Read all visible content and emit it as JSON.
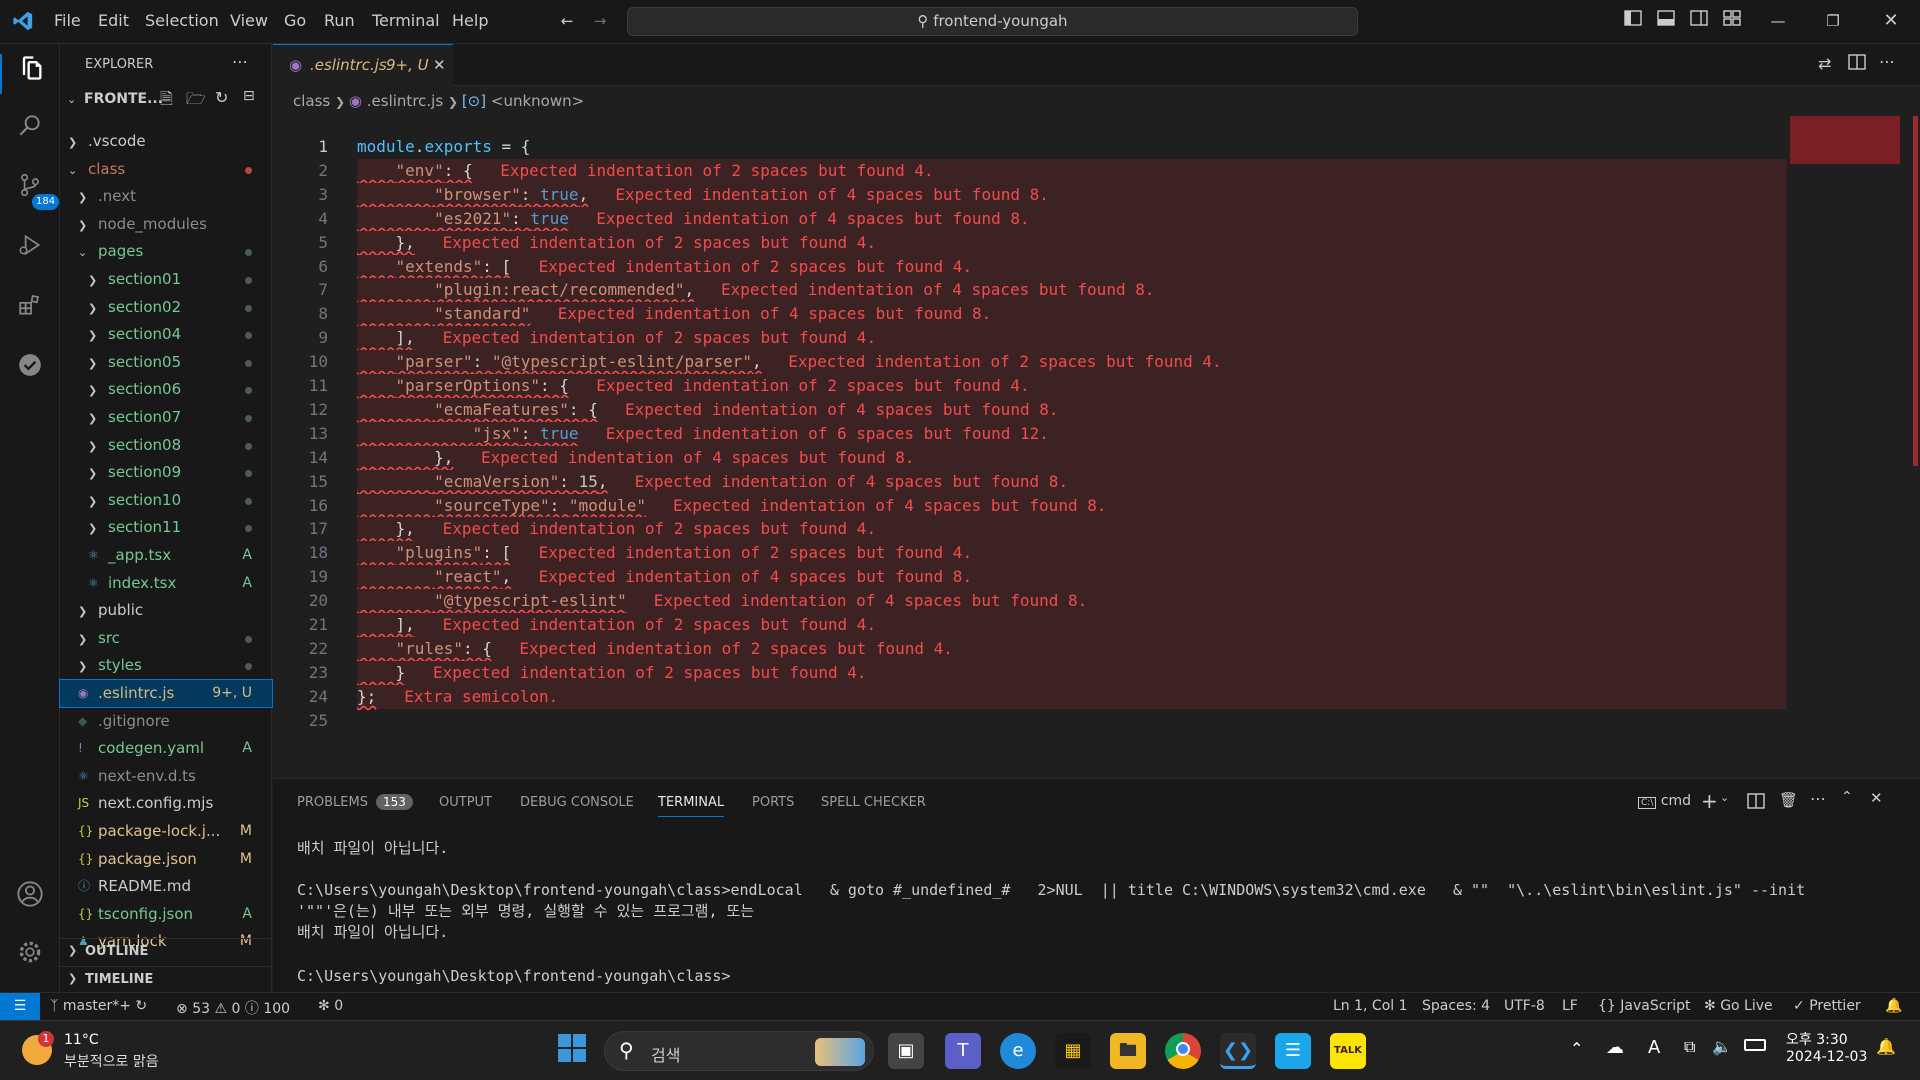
{
  "titlebar": {
    "menu": [
      "File",
      "Edit",
      "Selection",
      "View",
      "Go",
      "Run",
      "Terminal",
      "Help"
    ],
    "search_text": "frontend-youngah"
  },
  "activity": {
    "scm_badge": "184"
  },
  "explorer": {
    "title": "EXPLORER",
    "root": "FRONTE...",
    "rows": [
      {
        "label": ".vscode",
        "indent": 1,
        "kind": "folder",
        "status": ""
      },
      {
        "label": "class",
        "indent": 1,
        "kind": "folder-open",
        "status": "dot-red"
      },
      {
        "label": ".next",
        "indent": 2,
        "kind": "folder",
        "status": ""
      },
      {
        "label": "node_modules",
        "indent": 2,
        "kind": "folder",
        "status": ""
      },
      {
        "label": "pages",
        "indent": 2,
        "kind": "folder-open",
        "status": "dot"
      },
      {
        "label": "section01",
        "indent": 3,
        "kind": "folder",
        "status": "dot"
      },
      {
        "label": "section02",
        "indent": 3,
        "kind": "folder",
        "status": "dot"
      },
      {
        "label": "section04",
        "indent": 3,
        "kind": "folder",
        "status": "dot"
      },
      {
        "label": "section05",
        "indent": 3,
        "kind": "folder",
        "status": "dot"
      },
      {
        "label": "section06",
        "indent": 3,
        "kind": "folder",
        "status": "dot"
      },
      {
        "label": "section07",
        "indent": 3,
        "kind": "folder",
        "status": "dot"
      },
      {
        "label": "section08",
        "indent": 3,
        "kind": "folder",
        "status": "dot"
      },
      {
        "label": "section09",
        "indent": 3,
        "kind": "folder",
        "status": "dot"
      },
      {
        "label": "section10",
        "indent": 3,
        "kind": "folder",
        "status": "dot"
      },
      {
        "label": "section11",
        "indent": 3,
        "kind": "folder",
        "status": "dot"
      },
      {
        "label": "_app.tsx",
        "indent": 3,
        "kind": "file",
        "status": "A"
      },
      {
        "label": "index.tsx",
        "indent": 3,
        "kind": "file",
        "status": "A"
      },
      {
        "label": "public",
        "indent": 2,
        "kind": "folder",
        "status": ""
      },
      {
        "label": "src",
        "indent": 2,
        "kind": "folder",
        "status": "dot"
      },
      {
        "label": "styles",
        "indent": 2,
        "kind": "folder",
        "status": "dot"
      },
      {
        "label": ".eslintrc.js",
        "indent": 2,
        "kind": "file",
        "status": "9+, U"
      },
      {
        "label": ".gitignore",
        "indent": 2,
        "kind": "file",
        "status": ""
      },
      {
        "label": "codegen.yaml",
        "indent": 2,
        "kind": "file",
        "status": "A"
      },
      {
        "label": "next-env.d.ts",
        "indent": 2,
        "kind": "file",
        "status": ""
      },
      {
        "label": "next.config.mjs",
        "indent": 2,
        "kind": "file",
        "status": ""
      },
      {
        "label": "package-lock.j...",
        "indent": 2,
        "kind": "file",
        "status": "M"
      },
      {
        "label": "package.json",
        "indent": 2,
        "kind": "file",
        "status": "M"
      },
      {
        "label": "README.md",
        "indent": 2,
        "kind": "file",
        "status": ""
      },
      {
        "label": "tsconfig.json",
        "indent": 2,
        "kind": "file",
        "status": "A"
      },
      {
        "label": "yarn.lock",
        "indent": 2,
        "kind": "file",
        "status": "M"
      }
    ],
    "outline": "OUTLINE",
    "timeline": "TIMELINE"
  },
  "editor": {
    "tab_label": ".eslintrc.js",
    "tab_status": "9+, U",
    "breadcrumb": [
      "class",
      ".eslintrc.js",
      "<unknown>"
    ],
    "lines": [
      {
        "n": "1",
        "code": "module.exports = {",
        "diag": ""
      },
      {
        "n": "2",
        "code": "    \"env\": {",
        "diag": "Expected indentation of 2 spaces but found 4."
      },
      {
        "n": "3",
        "code": "        \"browser\": true,",
        "diag": "Expected indentation of 4 spaces but found 8."
      },
      {
        "n": "4",
        "code": "        \"es2021\": true",
        "diag": "Expected indentation of 4 spaces but found 8."
      },
      {
        "n": "5",
        "code": "    },",
        "diag": "Expected indentation of 2 spaces but found 4."
      },
      {
        "n": "6",
        "code": "    \"extends\": [",
        "diag": "Expected indentation of 2 spaces but found 4."
      },
      {
        "n": "7",
        "code": "        \"plugin:react/recommended\",",
        "diag": "Expected indentation of 4 spaces but found 8."
      },
      {
        "n": "8",
        "code": "        \"standard\"",
        "diag": "Expected indentation of 4 spaces but found 8."
      },
      {
        "n": "9",
        "code": "    ],",
        "diag": "Expected indentation of 2 spaces but found 4."
      },
      {
        "n": "10",
        "code": "    \"parser\": \"@typescript-eslint/parser\",",
        "diag": "Expected indentation of 2 spaces but found 4."
      },
      {
        "n": "11",
        "code": "    \"parserOptions\": {",
        "diag": "Expected indentation of 2 spaces but found 4."
      },
      {
        "n": "12",
        "code": "        \"ecmaFeatures\": {",
        "diag": "Expected indentation of 4 spaces but found 8."
      },
      {
        "n": "13",
        "code": "            \"jsx\": true",
        "diag": "Expected indentation of 6 spaces but found 12."
      },
      {
        "n": "14",
        "code": "        },",
        "diag": "Expected indentation of 4 spaces but found 8."
      },
      {
        "n": "15",
        "code": "        \"ecmaVersion\": 15,",
        "diag": "Expected indentation of 4 spaces but found 8."
      },
      {
        "n": "16",
        "code": "        \"sourceType\": \"module\"",
        "diag": "Expected indentation of 4 spaces but found 8."
      },
      {
        "n": "17",
        "code": "    },",
        "diag": "Expected indentation of 2 spaces but found 4."
      },
      {
        "n": "18",
        "code": "    \"plugins\": [",
        "diag": "Expected indentation of 2 spaces but found 4."
      },
      {
        "n": "19",
        "code": "        \"react\",",
        "diag": "Expected indentation of 4 spaces but found 8."
      },
      {
        "n": "20",
        "code": "        \"@typescript-eslint\"",
        "diag": "Expected indentation of 4 spaces but found 8."
      },
      {
        "n": "21",
        "code": "    ],",
        "diag": "Expected indentation of 2 spaces but found 4."
      },
      {
        "n": "22",
        "code": "    \"rules\": {",
        "diag": "Expected indentation of 2 spaces but found 4."
      },
      {
        "n": "23",
        "code": "    }",
        "diag": "Expected indentation of 2 spaces but found 4."
      },
      {
        "n": "24",
        "code": "};",
        "diag": "Extra semicolon."
      },
      {
        "n": "25",
        "code": "",
        "diag": ""
      }
    ]
  },
  "panel": {
    "tabs": [
      "PROBLEMS",
      "OUTPUT",
      "DEBUG CONSOLE",
      "TERMINAL",
      "PORTS",
      "SPELL CHECKER"
    ],
    "problems_count": "153",
    "active_tab": "TERMINAL",
    "shell": "cmd",
    "terminal_lines": [
      "배치 파일이 아닙니다.",
      "",
      "C:\\Users\\youngah\\Desktop\\frontend-youngah\\class>endLocal   & goto #_undefined_#   2>NUL  || title C:\\WINDOWS\\system32\\cmd.exe   & \"\"  \"\\..\\eslint\\bin\\eslint.js\" --init",
      "'\"\"'은(는) 내부 또는 외부 명령, 실행할 수 있는 프로그램, 또는",
      "배치 파일이 아닙니다.",
      "",
      "C:\\Users\\youngah\\Desktop\\frontend-youngah\\class>"
    ]
  },
  "statusbar": {
    "branch": "master*+",
    "errors": "53",
    "warnings": "0",
    "infos": "100",
    "ports": "0",
    "position": "Ln 1, Col 1",
    "spaces": "Spaces: 4",
    "encoding": "UTF-8",
    "eol": "LF",
    "language": "JavaScript",
    "golive": "Go Live",
    "prettier": "Prettier"
  },
  "taskbar": {
    "weather_temp": "11°C",
    "weather_desc": "부분적으로 맑음",
    "weather_badge": "1",
    "search_placeholder": "검색",
    "time": "오후 3:30",
    "date": "2024-12-03"
  }
}
